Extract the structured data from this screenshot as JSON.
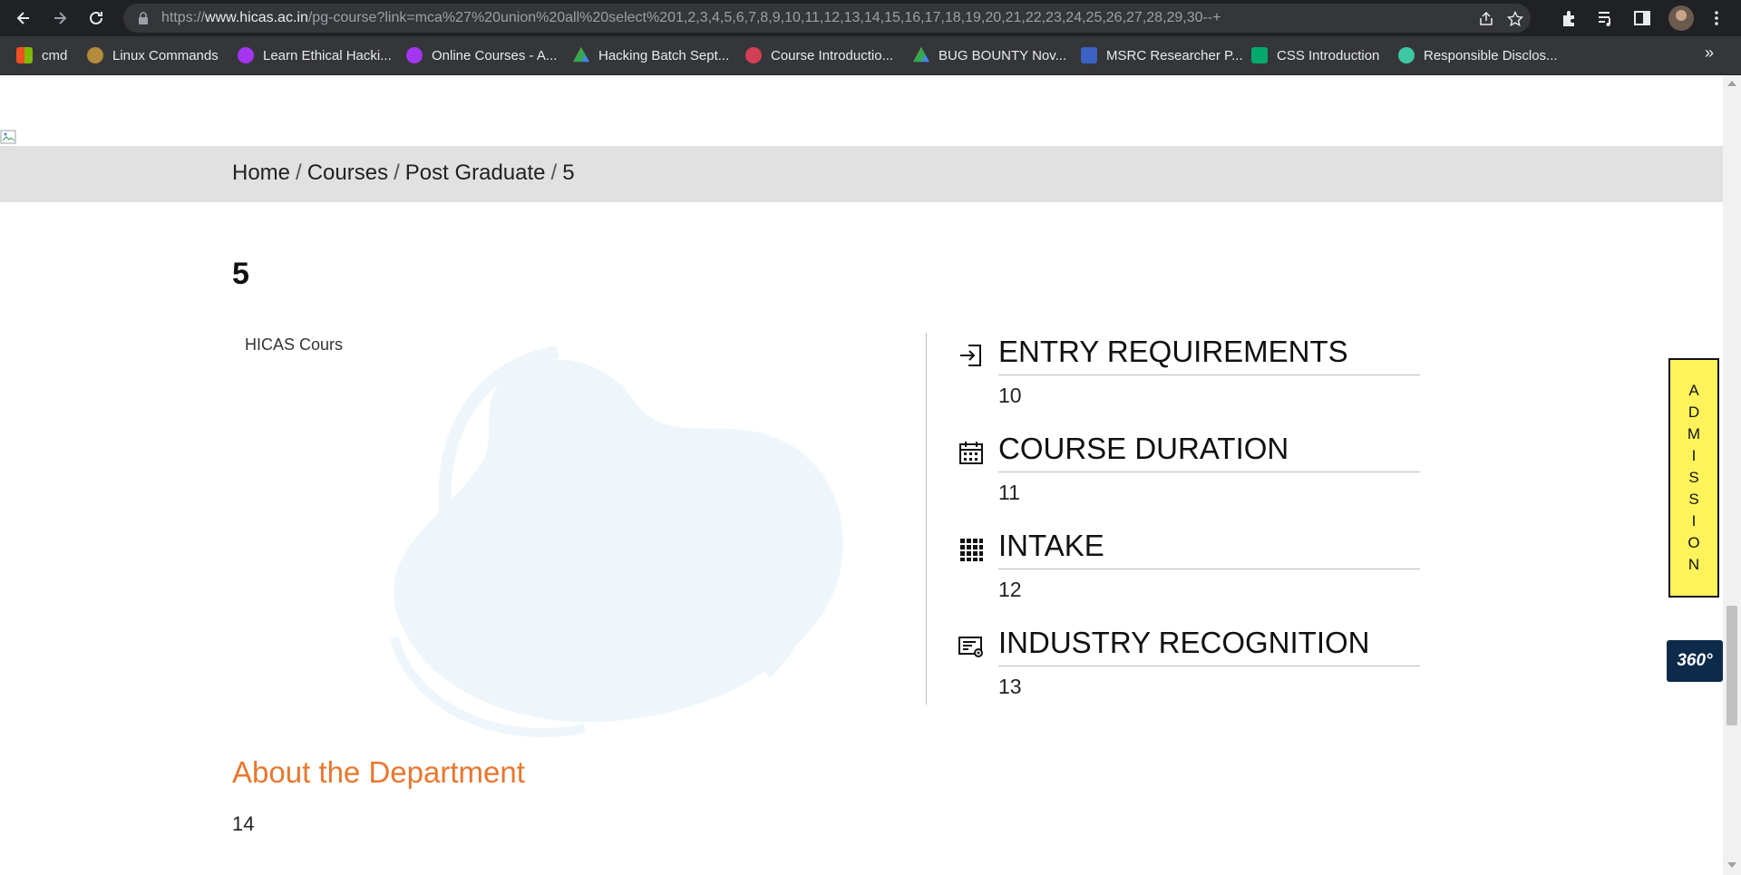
{
  "browser": {
    "url_prefix": "https://",
    "url_host": "www.hicas.ac.in",
    "url_path": "/pg-course?link=mca%27%20union%20all%20select%201,2,3,4,5,6,7,8,9,10,11,12,13,14,15,16,17,18,19,20,21,22,23,24,25,26,27,28,29,30--+"
  },
  "bookmarks": [
    {
      "label": "cmd",
      "color": "#f25022"
    },
    {
      "label": "Linux Commands",
      "color": "#b38b3b"
    },
    {
      "label": "Learn Ethical Hacki...",
      "color": "#a435f0"
    },
    {
      "label": "Online Courses - A...",
      "color": "#a435f0"
    },
    {
      "label": "Hacking Batch Sept...",
      "color": "#34a853"
    },
    {
      "label": "Course Introductio...",
      "color": "#d23f57"
    },
    {
      "label": "BUG BOUNTY Nov...",
      "color": "#fbbc04"
    },
    {
      "label": "MSRC Researcher P...",
      "color": "#3b62c4"
    },
    {
      "label": "CSS Introduction",
      "color": "#04aa6d"
    },
    {
      "label": "Responsible Disclos...",
      "color": "#3ec7a3"
    }
  ],
  "breadcrumb": {
    "home": "Home",
    "courses": "Courses",
    "post_graduate": "Post Graduate",
    "current": "5",
    "separator": "/"
  },
  "course": {
    "title": "5",
    "image_alt": "HICAS Cours"
  },
  "info": [
    {
      "label": "ENTRY REQUIREMENTS",
      "value": "10",
      "icon": "sign-in-icon"
    },
    {
      "label": "COURSE DURATION",
      "value": "11",
      "icon": "calendar-icon"
    },
    {
      "label": "INTAKE",
      "value": "12",
      "icon": "grid-dots-icon"
    },
    {
      "label": "INDUSTRY RECOGNITION",
      "value": "13",
      "icon": "certificate-icon"
    }
  ],
  "about": {
    "heading": "About the Department",
    "text": "14"
  },
  "admission_letters": [
    "A",
    "D",
    "M",
    "I",
    "S",
    "S",
    "I",
    "O",
    "N"
  ],
  "tour_label": "360°",
  "colors": {
    "accent_orange": "#e8772e",
    "admission_yellow": "#fff35c",
    "tour_navy": "#0e2a4a",
    "breadcrumb_bg": "#e1e1e1"
  }
}
